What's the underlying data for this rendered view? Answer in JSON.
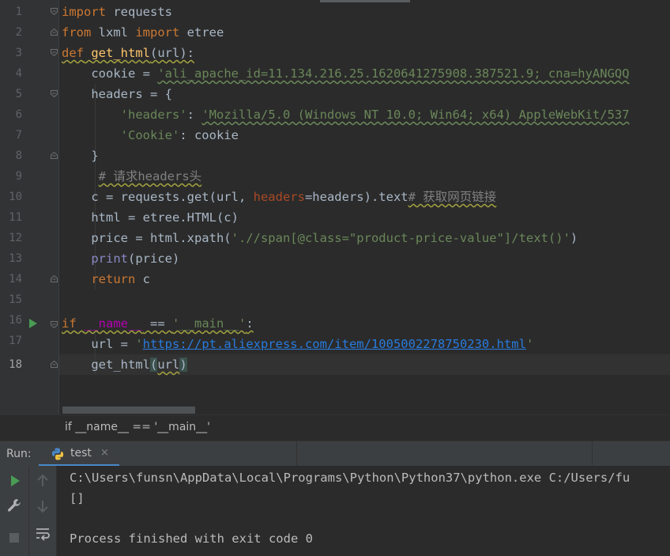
{
  "editor": {
    "line_numbers": [
      "1",
      "2",
      "3",
      "4",
      "5",
      "6",
      "7",
      "8",
      "9",
      "10",
      "11",
      "12",
      "13",
      "14",
      "15",
      "16",
      "17",
      "18"
    ],
    "lines": {
      "l1": {
        "kw": "import",
        "rest": " requests"
      },
      "l2": {
        "kw1": "from",
        "mid": " lxml ",
        "kw2": "import",
        "rest": " etree"
      },
      "l3": {
        "kw": "def",
        "sp": " ",
        "fn": "get_html",
        "rest": "(url):"
      },
      "l4": {
        "pre": "    cookie = ",
        "str": "'ali_apache_id=11.134.216.25.1620641275908.387521.9; cna=hyANGQQ"
      },
      "l5": {
        "text": "    headers = {"
      },
      "l6": {
        "indent": "        ",
        "key": "'headers'",
        "colon": ": ",
        "str": "'Mozilla/5.0 (Windows NT 10.0; Win64; x64) AppleWebKit/537"
      },
      "l7": {
        "indent": "        ",
        "key": "'Cookie'",
        "rest": ": cookie"
      },
      "l8": {
        "text": "    }"
      },
      "l9": {
        "indent": "     ",
        "comment": "# 请求headers头"
      },
      "l10": {
        "pre": "    c = requests.get(url, ",
        "param": "headers",
        "mid": "=headers).text",
        "comment": "# 获取网页链接"
      },
      "l11": {
        "text": "    html = etree.HTML(c)"
      },
      "l12": {
        "pre": "    price = html.xpath(",
        "str": "'.//span[@class=\"product-price-value\"]/text()'",
        "rest": ")"
      },
      "l13": {
        "indent": "    ",
        "bi": "print",
        "rest": "(price)"
      },
      "l14": {
        "indent": "    ",
        "kw": "return",
        "rest": " c"
      },
      "l16": {
        "kw": "if",
        "sp": " ",
        "dunder": "__name__",
        "mid": " == ",
        "str": "'__main__'",
        "rest": ":"
      },
      "l17": {
        "pre": "    url = ",
        "q1": "'",
        "url": "https://pt.aliexpress.com/item/1005002278750230.html",
        "q2": "'"
      },
      "l18": {
        "pre": "    get_html",
        "open": "(",
        "arg": "url",
        "close": ")"
      }
    }
  },
  "breadcrumb": {
    "text": "if __name__ == '__main__'"
  },
  "run_panel": {
    "label": "Run:",
    "tab_name": "test",
    "tab_close": "×"
  },
  "console": {
    "lines": [
      "C:\\Users\\funsn\\AppData\\Local\\Programs\\Python\\Python37\\python.exe C:/Users/fu",
      "[]",
      "",
      "Process finished with exit code 0"
    ]
  },
  "colors": {
    "keyword": "#cc7832",
    "function": "#ffc66d",
    "string": "#6a8759",
    "comment": "#808080",
    "parameter": "#aa4926",
    "link": "#287bde",
    "builtin": "#8888c6",
    "dunder": "#b200b2",
    "run_green": "#499c54",
    "background": "#2b2b2b"
  },
  "icons": {
    "run": "play-icon",
    "wrench": "wrench-icon",
    "stop": "stop-icon",
    "up": "arrow-up-icon",
    "down": "arrow-down-icon",
    "wrap": "soft-wrap-icon",
    "python": "python-icon"
  }
}
